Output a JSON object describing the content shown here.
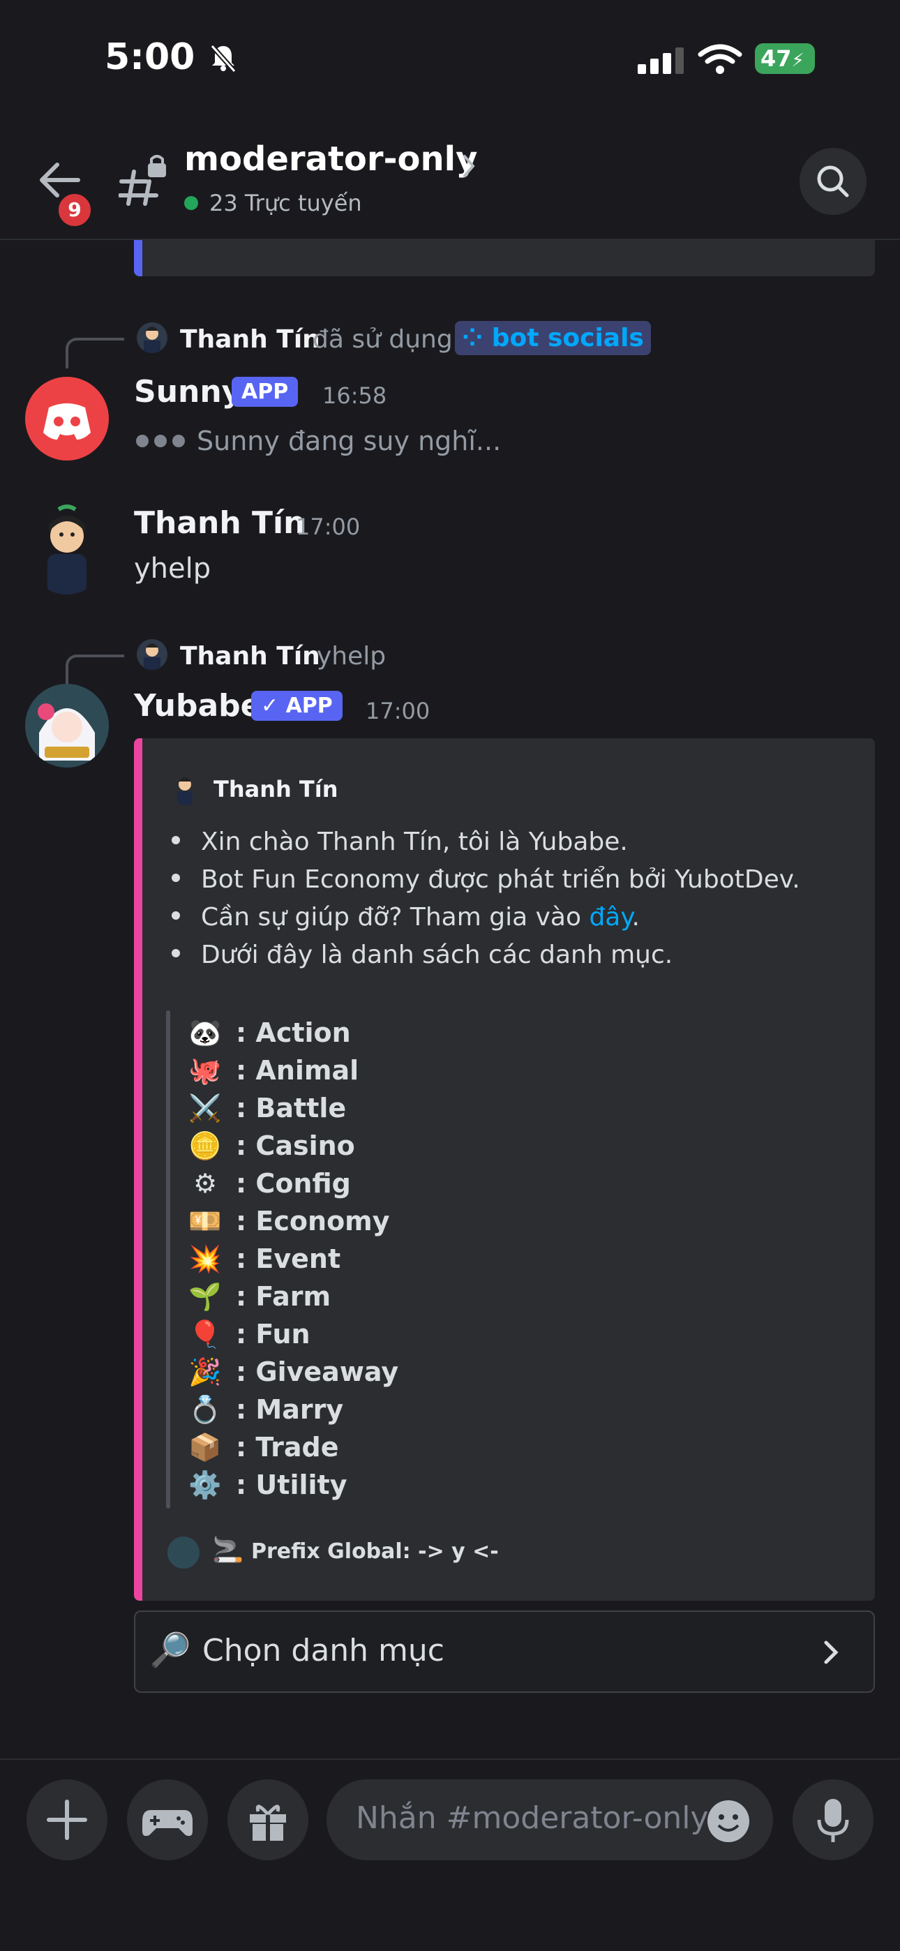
{
  "status_bar": {
    "time": "5:00",
    "battery": "47"
  },
  "header": {
    "channel": "moderator-only",
    "online": "23 Trực tuyến",
    "back_badge": "9"
  },
  "messages": {
    "sunny_reply": {
      "user": "Thanh Tín",
      "action": "đã sử dụng",
      "command": "bot socials"
    },
    "sunny": {
      "author": "Sunny",
      "tag": "APP",
      "time": "16:58",
      "thinking": "Sunny đang suy nghĩ..."
    },
    "thanh": {
      "author": "Thanh Tín",
      "time": "17:00",
      "text": "yhelp"
    },
    "yubabe_reply": {
      "user": "Thanh Tín",
      "text": "yhelp"
    },
    "yubabe": {
      "author": "Yubabe",
      "tag": "✓ APP",
      "time": "17:00"
    }
  },
  "embed": {
    "author": "Thanh Tín",
    "bullets": [
      "Xin chào Thanh Tín, tôi là Yubabe.",
      "Bot Fun Economy được phát triển bởi YubotDev.",
      "Cần sự giúp đỡ? Tham gia vào ",
      "Dưới đây là danh sách các danh mục."
    ],
    "link_text": "đây",
    "link_suffix": ".",
    "categories": [
      {
        "emoji": "🐼",
        "label": ": Action"
      },
      {
        "emoji": "🐙",
        "label": ": Animal"
      },
      {
        "emoji": "⚔️",
        "label": ": Battle"
      },
      {
        "emoji": "🪙",
        "label": ": Casino"
      },
      {
        "emoji": "⚙",
        "label": ": Config"
      },
      {
        "emoji": "💴",
        "label": ": Economy"
      },
      {
        "emoji": "💥",
        "label": ": Event"
      },
      {
        "emoji": "🌱",
        "label": ": Farm"
      },
      {
        "emoji": "🎈",
        "label": ": Fun"
      },
      {
        "emoji": "🎉",
        "label": ": Giveaway"
      },
      {
        "emoji": "💍",
        "label": ": Marry"
      },
      {
        "emoji": "📦",
        "label": ": Trade"
      },
      {
        "emoji": "⚙️",
        "label": ": Utility"
      }
    ],
    "footer": "Prefix Global: -> y <-"
  },
  "select_menu": {
    "icon": "🔎",
    "label": "Chọn danh mục"
  },
  "composer": {
    "placeholder": "Nhắn #moderator-only"
  },
  "colors": {
    "accent": "#5865f2",
    "embed_bar": "#eb459f",
    "link": "#00a8fc",
    "discord_red": "#ed4245"
  }
}
